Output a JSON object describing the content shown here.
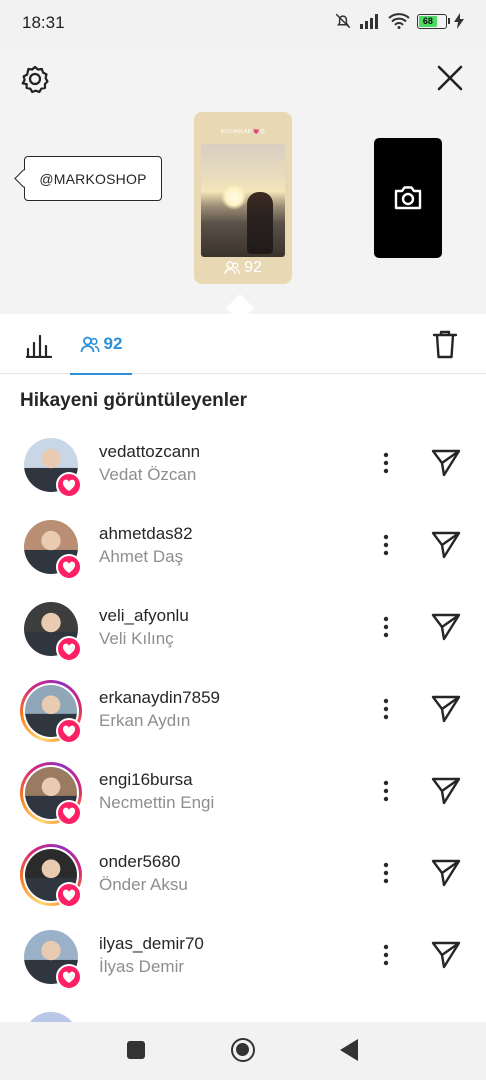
{
  "status_bar": {
    "time": "18:31",
    "battery": "68"
  },
  "story": {
    "mention": "@MARKOSHOP",
    "caption": "BiYCANLAR 💗😍",
    "viewer_count": "92"
  },
  "tabs": {
    "viewers_count": "92"
  },
  "section_title": "Hikayeni görüntüleyenler",
  "viewers": [
    {
      "username": "vedattozcann",
      "fullname": "Vedat Özcan",
      "ring": false,
      "avatar_color": "#c9d6e6"
    },
    {
      "username": "ahmetdas82",
      "fullname": "Ahmet Daş",
      "ring": false,
      "avatar_color": "#b98e72"
    },
    {
      "username": "veli_afyonlu",
      "fullname": "Veli Kılınç",
      "ring": false,
      "avatar_color": "#3d3d3d"
    },
    {
      "username": "erkanaydin7859",
      "fullname": "Erkan Aydın",
      "ring": true,
      "avatar_color": "#8fa7b8"
    },
    {
      "username": "engi16bursa",
      "fullname": "Necmettin Engi",
      "ring": true,
      "avatar_color": "#9b7a62"
    },
    {
      "username": "onder5680",
      "fullname": "Önder Aksu",
      "ring": true,
      "avatar_color": "#2b2b2b"
    },
    {
      "username": "ilyas_demir70",
      "fullname": "İlyas Demir",
      "ring": false,
      "avatar_color": "#9bb0c9"
    },
    {
      "username": "",
      "fullname": "",
      "ring": false,
      "avatar_color": "#b9c8e8"
    }
  ]
}
